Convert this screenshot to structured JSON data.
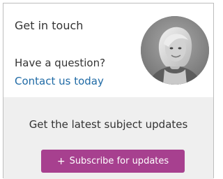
{
  "contact": {
    "title": "Get in touch",
    "question": "Have a question?",
    "link_label": "Contact us today"
  },
  "subscribe": {
    "text": "Get the latest subject updates",
    "button_icon": "plus-icon",
    "button_icon_glyph": "+",
    "button_label": "Subscribe for updates",
    "button_color": "#a7408f"
  },
  "colors": {
    "link": "#1f6aa5",
    "panel_bg": "#efefef",
    "border": "#bdbdbd"
  }
}
